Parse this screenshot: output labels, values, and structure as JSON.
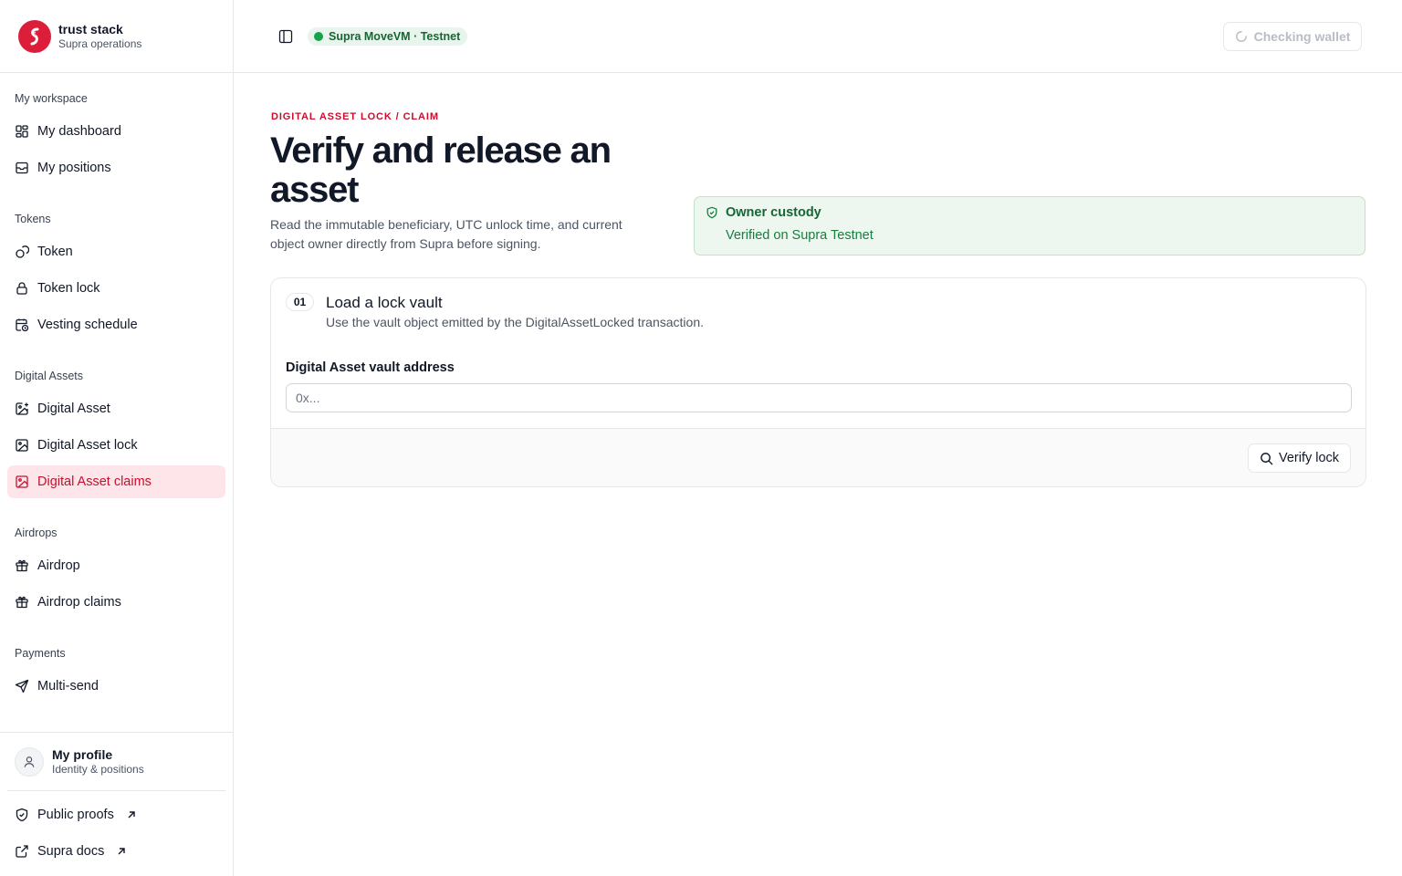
{
  "brand": {
    "name": "trust stack",
    "subtitle": "Supra operations"
  },
  "sidebar": {
    "sections": [
      {
        "label": "My workspace",
        "items": [
          {
            "label": "My dashboard",
            "icon": "dashboard-icon"
          },
          {
            "label": "My positions",
            "icon": "inbox-icon"
          }
        ]
      },
      {
        "label": "Tokens",
        "items": [
          {
            "label": "Token",
            "icon": "coins-icon"
          },
          {
            "label": "Token lock",
            "icon": "lock-icon"
          },
          {
            "label": "Vesting schedule",
            "icon": "calendar-clock-icon"
          }
        ]
      },
      {
        "label": "Digital Assets",
        "items": [
          {
            "label": "Digital Asset",
            "icon": "image-plus-icon"
          },
          {
            "label": "Digital Asset lock",
            "icon": "image-icon"
          },
          {
            "label": "Digital Asset claims",
            "icon": "image-icon",
            "active": true
          }
        ]
      },
      {
        "label": "Airdrops",
        "items": [
          {
            "label": "Airdrop",
            "icon": "gift-icon"
          },
          {
            "label": "Airdrop claims",
            "icon": "gift-icon"
          }
        ]
      },
      {
        "label": "Payments",
        "items": [
          {
            "label": "Multi-send",
            "icon": "send-icon"
          }
        ]
      }
    ],
    "profile": {
      "name": "My profile",
      "subtitle": "Identity & positions"
    },
    "footer_links": [
      {
        "label": "Public proofs",
        "icon": "shield-icon"
      },
      {
        "label": "Supra docs",
        "icon": "external-link-icon"
      }
    ]
  },
  "topbar": {
    "network_label": "Supra MoveVM · Testnet",
    "wallet_button": "Checking wallet"
  },
  "page": {
    "eyebrow": "DIGITAL ASSET LOCK / CLAIM",
    "title": "Verify and release an asset",
    "description": "Read the immutable beneficiary, UTC unlock time, and current object owner directly from Supra before signing.",
    "custody": {
      "title": "Owner custody",
      "status": "Verified on Supra Testnet"
    }
  },
  "card": {
    "step_number": "01",
    "step_title": "Load a lock vault",
    "step_subtitle": "Use the vault object emitted by the DigitalAssetLocked transaction.",
    "field_label": "Digital Asset vault address",
    "field_value": "",
    "field_placeholder": "0x...",
    "button_label": "Verify lock"
  },
  "colors": {
    "accent": "#c8102e",
    "accent_bg": "#fde5e9",
    "success": "#15803d",
    "success_bg": "#edf7f0"
  }
}
